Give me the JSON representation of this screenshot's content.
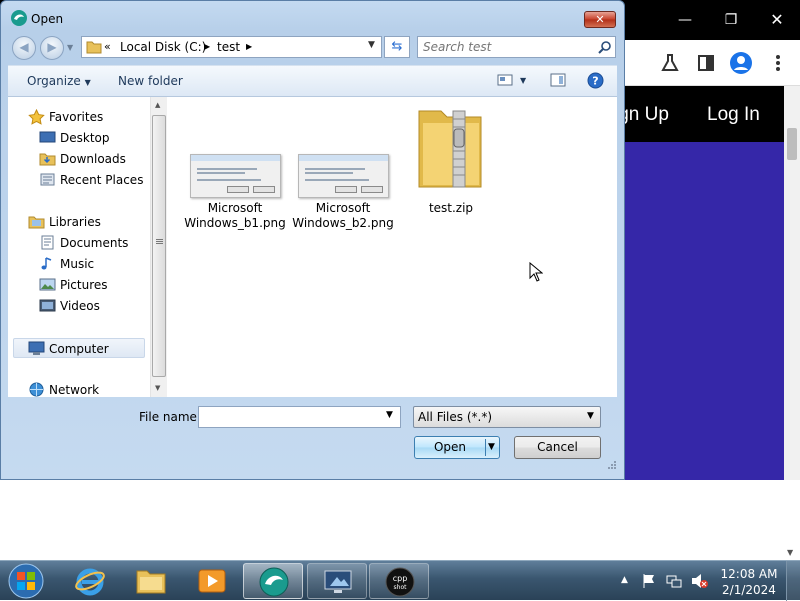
{
  "dialog": {
    "title": "Open",
    "address": {
      "overflow": "«",
      "segments": [
        "Local Disk (C:)",
        "test"
      ]
    },
    "search": {
      "placeholder": "Search test"
    },
    "commands": {
      "organize": "Organize",
      "new_folder": "New folder"
    },
    "nav": {
      "favorites": {
        "label": "Favorites",
        "items": [
          "Desktop",
          "Downloads",
          "Recent Places"
        ]
      },
      "libraries": {
        "label": "Libraries",
        "items": [
          "Documents",
          "Music",
          "Pictures",
          "Videos"
        ]
      },
      "computer": "Computer",
      "network": "Network"
    },
    "files": [
      {
        "name_line1": "Microsoft",
        "name_line2": "Windows_b1.png",
        "icon": "image-thumbnail-icon"
      },
      {
        "name_line1": "Microsoft",
        "name_line2": "Windows_b2.png",
        "icon": "image-thumbnail-icon"
      },
      {
        "name_line1": "test.zip",
        "name_line2": "",
        "icon": "zip-folder-icon"
      }
    ],
    "filename_label": "File name:",
    "filename_value": "",
    "filter": "All Files (*.*)",
    "open_label": "Open",
    "cancel_label": "Cancel"
  },
  "browser": {
    "nav_links": {
      "sign_up": "ign Up",
      "log_in": "Log In"
    },
    "accent_color": "#3527a8"
  },
  "taskbar": {
    "time": "12:08 AM",
    "date": "2/1/2024",
    "apps": [
      "start-orb",
      "internet-explorer",
      "file-explorer",
      "media-player",
      "app-swirl",
      "screen-tool",
      "cpp-shot"
    ]
  }
}
